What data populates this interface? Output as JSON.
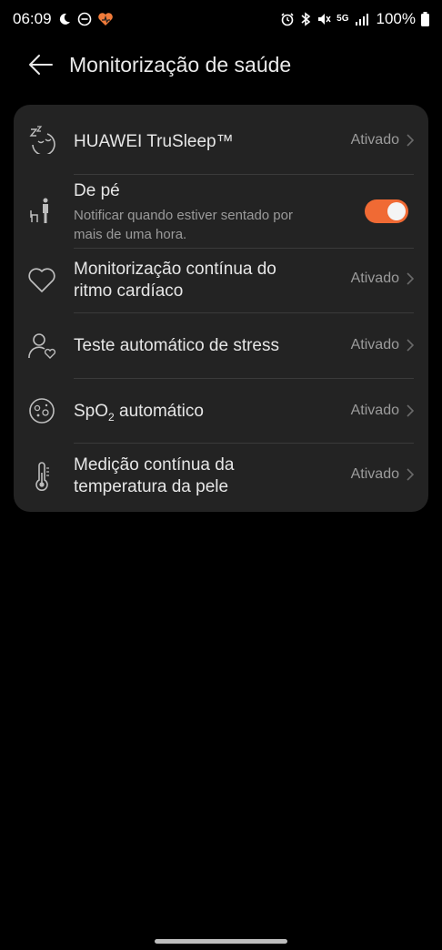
{
  "status_bar": {
    "time": "06:09",
    "battery": "100%",
    "network": "5G"
  },
  "header": {
    "title": "Monitorização de saúde"
  },
  "items": [
    {
      "title": "HUAWEI TruSleep™",
      "status": "Ativado",
      "icon": "sleep-icon"
    },
    {
      "title": "De pé",
      "subtitle_line1": "Notificar quando estiver sentado por",
      "subtitle_line2": "mais de uma hora.",
      "toggle_on": true,
      "icon": "standing-icon"
    },
    {
      "title_line1": "Monitorização contínua do",
      "title_line2": "ritmo cardíaco",
      "status": "Ativado",
      "icon": "heart-icon"
    },
    {
      "title": "Teste automático de stress",
      "status": "Ativado",
      "icon": "stress-icon"
    },
    {
      "title_prefix": "SpO",
      "title_sub": "2",
      "title_suffix": " automático",
      "status": "Ativado",
      "icon": "spo2-icon"
    },
    {
      "title_line1": "Medição contínua da",
      "title_line2": "temperatura da pele",
      "status": "Ativado",
      "icon": "thermometer-icon"
    }
  ],
  "colors": {
    "accent": "#f06a34",
    "card": "#232323",
    "background": "#000000"
  }
}
